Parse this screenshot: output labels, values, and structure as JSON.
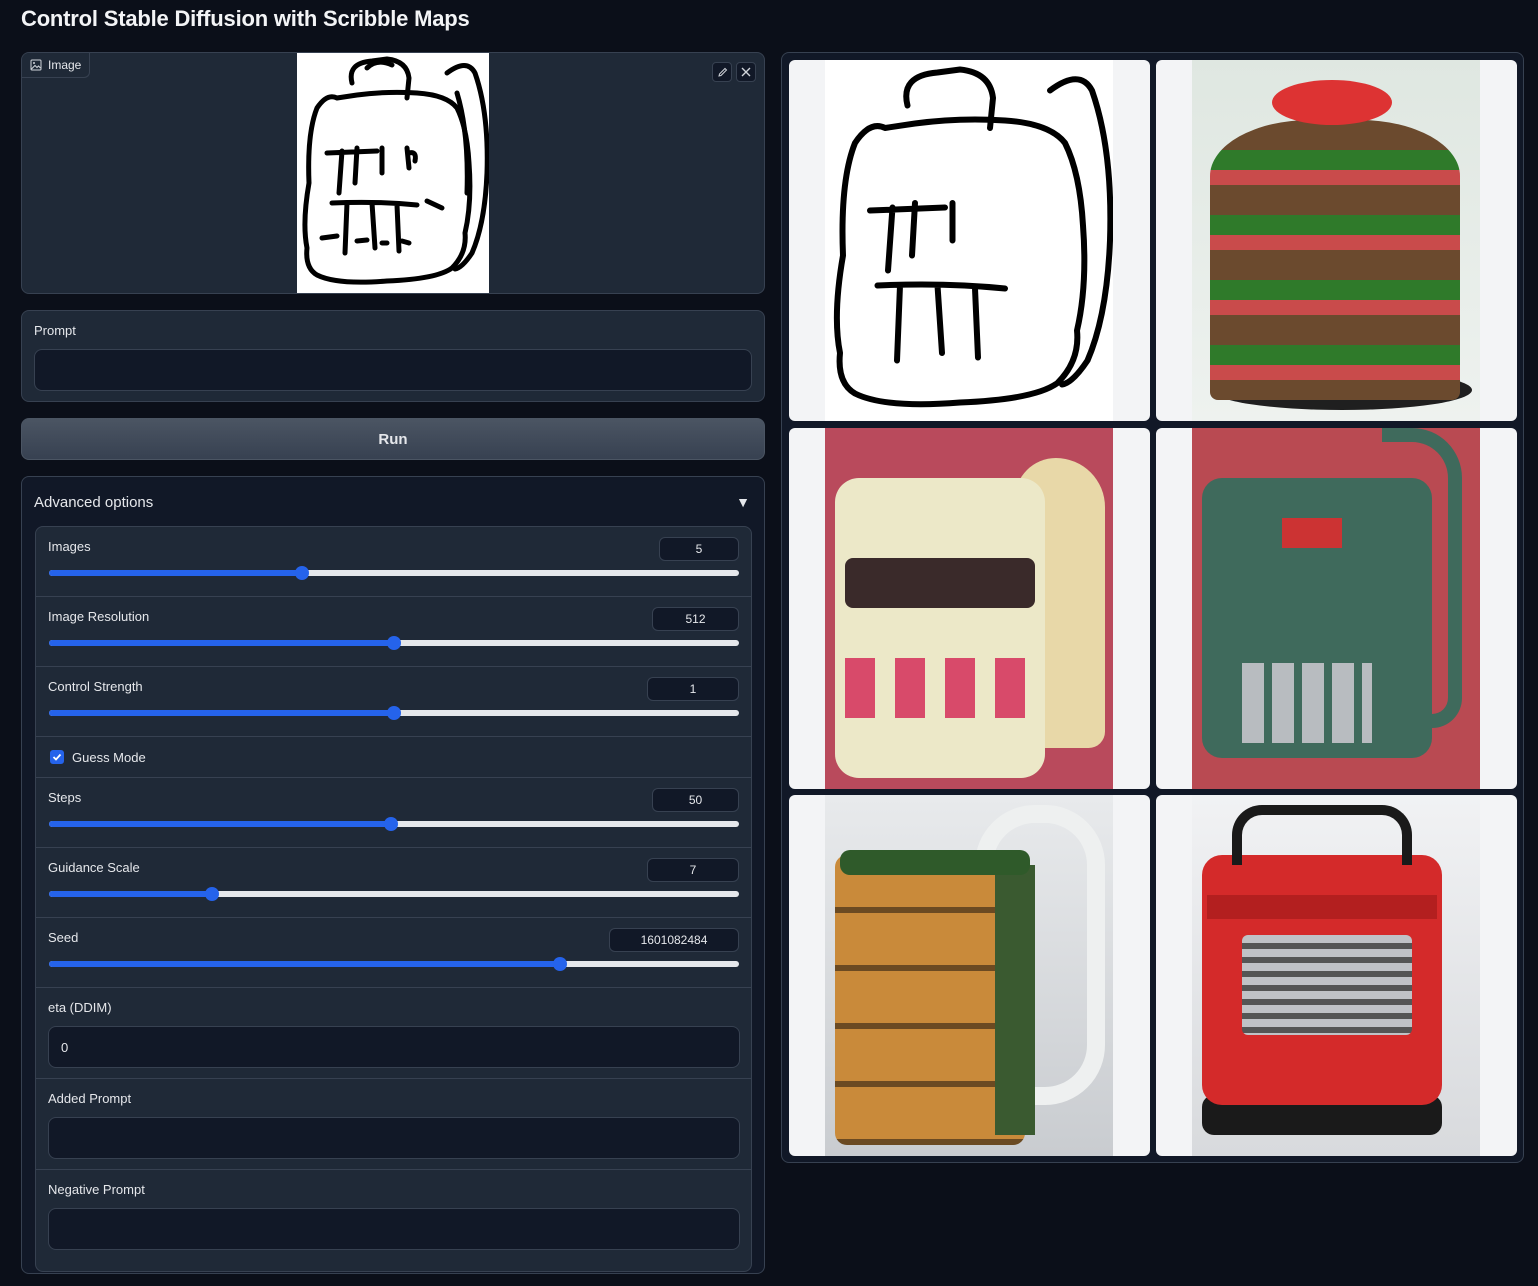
{
  "app": {
    "title": "Control Stable Diffusion with Scribble Maps"
  },
  "image_input": {
    "label": "Image",
    "edit_icon": "pencil-icon",
    "close_icon": "x-icon"
  },
  "prompt": {
    "label": "Prompt",
    "value": ""
  },
  "run_button": {
    "label": "Run"
  },
  "advanced": {
    "header": "Advanced options",
    "toggle_icon": "▼",
    "images": {
      "label": "Images",
      "value": "5",
      "fraction": 0.367
    },
    "resolution": {
      "label": "Image Resolution",
      "value": "512",
      "fraction": 0.5
    },
    "strength": {
      "label": "Control Strength",
      "value": "1",
      "fraction": 0.5
    },
    "guess_mode": {
      "label": "Guess Mode",
      "checked": true
    },
    "steps": {
      "label": "Steps",
      "value": "50",
      "fraction": 0.495
    },
    "guidance": {
      "label": "Guidance Scale",
      "value": "7",
      "fraction": 0.236
    },
    "seed": {
      "label": "Seed",
      "value": "1601082484",
      "fraction": 0.741
    },
    "eta": {
      "label": "eta (DDIM)",
      "value": "0"
    },
    "added_prompt": {
      "label": "Added Prompt",
      "value": ""
    },
    "negative_prompt": {
      "label": "Negative Prompt",
      "value": ""
    }
  },
  "colors": {
    "accent": "#2563eb",
    "background": "#0b0f19",
    "panel": "#1f2937"
  },
  "gallery": {
    "items": [
      {
        "subject": "scribble backpack"
      },
      {
        "subject": "layered cake"
      },
      {
        "subject": "cream backpack"
      },
      {
        "subject": "green machine backpack"
      },
      {
        "subject": "bread backpack"
      },
      {
        "subject": "red truck backpack"
      }
    ]
  }
}
